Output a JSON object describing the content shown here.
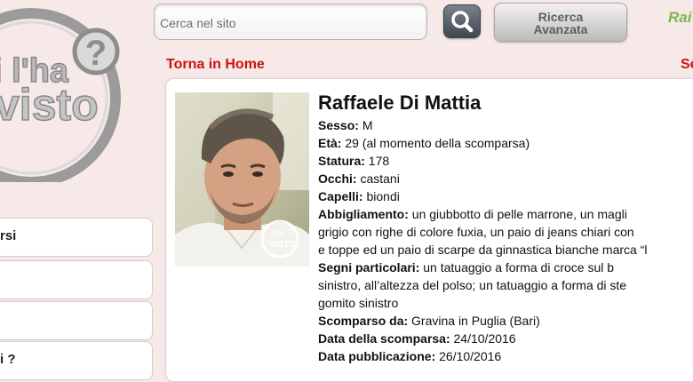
{
  "logo": {
    "text": "Chi l'ha Visto?"
  },
  "search": {
    "placeholder": "Cerca nel sito",
    "icon": "search-icon"
  },
  "advanced_search": {
    "line1": "Ricerca",
    "line2": "Avanzata"
  },
  "rai_logo": "Rai",
  "nav": {
    "home_link": "Torna in Home",
    "right_link": "Se"
  },
  "sidebar": {
    "items": [
      {
        "label": "rsi"
      },
      {
        "label": ""
      },
      {
        "label": ""
      },
      {
        "label": "i ?"
      }
    ]
  },
  "person": {
    "name": "Raffaele Di Mattia",
    "photo_watermark": "CHI l'ha VISTO?",
    "sesso": {
      "label": "Sesso:",
      "value": "M"
    },
    "eta": {
      "label": "Età:",
      "value": "29 (al momento della scomparsa)"
    },
    "statura": {
      "label": "Statura:",
      "value": "178"
    },
    "occhi": {
      "label": "Occhi:",
      "value": "castani"
    },
    "capelli": {
      "label": "Capelli:",
      "value": "biondi"
    },
    "abbigliamento": {
      "label": "Abbigliamento:",
      "line1": "un giubbotto di pelle marrone, un magli",
      "line2": "grigio con righe di colore fuxia, un paio di jeans chiari con",
      "line3": "e toppe ed un paio di scarpe da ginnastica bianche marca “l"
    },
    "segni": {
      "label": "Segni particolari:",
      "line1": "un tatuaggio a forma di croce sul b",
      "line2": "sinistro, all’altezza del polso; un tatuaggio a forma di ste",
      "line3": "gomito sinistro"
    },
    "scomparso_da": {
      "label": "Scomparso da:",
      "value": "Gravina in Puglia (Bari)"
    },
    "data_scomparsa": {
      "label": "Data della scomparsa:",
      "value": "24/10/2016"
    },
    "data_pubblicazione": {
      "label": "Data pubblicazione:",
      "value": "26/10/2016"
    }
  }
}
